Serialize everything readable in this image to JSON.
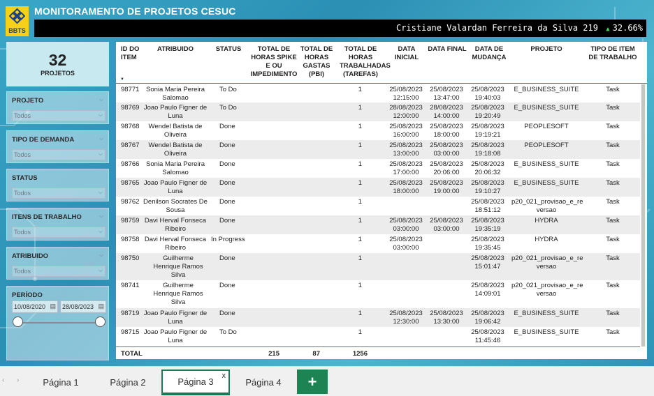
{
  "brand": {
    "logo_text": "BBTS"
  },
  "header": {
    "title": "MONITORAMENTO DE PROJETOS CESUC",
    "user_name": "Cristiane Valardan Ferreira da Silva",
    "user_count": "219",
    "trend_pct": "32.66%"
  },
  "kpi": {
    "value": "32",
    "label": "PROJETOS"
  },
  "filters": [
    {
      "title": "PROJETO",
      "value": "Todos"
    },
    {
      "title": "TIPO DE DEMANDA",
      "value": "Todos"
    },
    {
      "title": "STATUS",
      "value": "Todos"
    },
    {
      "title": "ITENS DE TRABALHO",
      "value": "Todos"
    },
    {
      "title": "ATRIBUIDO",
      "value": "Todos"
    }
  ],
  "periodo": {
    "title": "PERÍODO",
    "start": "10/08/2020",
    "end": "28/08/2023"
  },
  "table": {
    "columns": {
      "id": "ID DO ITEM",
      "atribuido": "ATRIBUIDO",
      "status": "STATUS",
      "horas_spike": "TOTAL DE HORAS SPIKE E OU IMPEDIMENTO",
      "horas_gastas": "TOTAL DE HORAS GASTAS (PBI)",
      "horas_trab": "TOTAL DE HORAS TRABALHADAS (TAREFAS)",
      "data_inicial": "DATA INICIAL",
      "data_final": "DATA FINAL",
      "data_mudanca": "DATA DE MUDANÇA",
      "projeto": "PROJETO",
      "tipo": "TIPO DE ITEM DE TRABALHO"
    },
    "rows": [
      {
        "id": "98771",
        "atribuido": "Sonia Maria Pereira Salomao",
        "status": "To Do",
        "horas_spike": "",
        "horas_gastas": "",
        "horas_trab": "1",
        "data_inicial": "25/08/2023 12:15:00",
        "data_final": "25/08/2023 13:47:00",
        "data_mudanca": "25/08/2023 19:40:03",
        "projeto": "E_BUSINESS_SUITE",
        "tipo": "Task"
      },
      {
        "id": "98769",
        "atribuido": "Joao Paulo Figner de Luna",
        "status": "To Do",
        "horas_spike": "",
        "horas_gastas": "",
        "horas_trab": "1",
        "data_inicial": "28/08/2023 12:00:00",
        "data_final": "28/08/2023 14:00:00",
        "data_mudanca": "25/08/2023 19:20:49",
        "projeto": "E_BUSINESS_SUITE",
        "tipo": "Task"
      },
      {
        "id": "98768",
        "atribuido": "Wendel Batista de Oliveira",
        "status": "Done",
        "horas_spike": "",
        "horas_gastas": "",
        "horas_trab": "1",
        "data_inicial": "25/08/2023 16:00:00",
        "data_final": "25/08/2023 18:00:00",
        "data_mudanca": "25/08/2023 19:19:21",
        "projeto": "PEOPLESOFT",
        "tipo": "Task"
      },
      {
        "id": "98767",
        "atribuido": "Wendel Batista de Oliveira",
        "status": "Done",
        "horas_spike": "",
        "horas_gastas": "",
        "horas_trab": "1",
        "data_inicial": "25/08/2023 13:00:00",
        "data_final": "25/08/2023 03:00:00",
        "data_mudanca": "25/08/2023 19:18:08",
        "projeto": "PEOPLESOFT",
        "tipo": "Task"
      },
      {
        "id": "98766",
        "atribuido": "Sonia Maria Pereira Salomao",
        "status": "Done",
        "horas_spike": "",
        "horas_gastas": "",
        "horas_trab": "1",
        "data_inicial": "25/08/2023 17:00:00",
        "data_final": "25/08/2023 20:06:00",
        "data_mudanca": "25/08/2023 20:06:32",
        "projeto": "E_BUSINESS_SUITE",
        "tipo": "Task"
      },
      {
        "id": "98765",
        "atribuido": "Joao Paulo Figner de Luna",
        "status": "Done",
        "horas_spike": "",
        "horas_gastas": "",
        "horas_trab": "1",
        "data_inicial": "25/08/2023 18:00:00",
        "data_final": "25/08/2023 19:00:00",
        "data_mudanca": "25/08/2023 19:10:27",
        "projeto": "E_BUSINESS_SUITE",
        "tipo": "Task"
      },
      {
        "id": "98762",
        "atribuido": "Denilson Socrates De Sousa",
        "status": "Done",
        "horas_spike": "",
        "horas_gastas": "",
        "horas_trab": "1",
        "data_inicial": "",
        "data_final": "",
        "data_mudanca": "25/08/2023 18:51:12",
        "projeto": "p20_021_provisao_e_re versao",
        "tipo": "Task"
      },
      {
        "id": "98759",
        "atribuido": "Davi Herval Fonseca Ribeiro",
        "status": "Done",
        "horas_spike": "",
        "horas_gastas": "",
        "horas_trab": "1",
        "data_inicial": "25/08/2023 03:00:00",
        "data_final": "25/08/2023 03:00:00",
        "data_mudanca": "25/08/2023 19:35:19",
        "projeto": "HYDRA",
        "tipo": "Task"
      },
      {
        "id": "98758",
        "atribuido": "Davi Herval Fonseca Ribeiro",
        "status": "In Progress",
        "horas_spike": "",
        "horas_gastas": "",
        "horas_trab": "1",
        "data_inicial": "25/08/2023 03:00:00",
        "data_final": "",
        "data_mudanca": "25/08/2023 19:35:45",
        "projeto": "HYDRA",
        "tipo": "Task"
      },
      {
        "id": "98750",
        "atribuido": "Guilherme Henrique Ramos Silva",
        "status": "Done",
        "horas_spike": "",
        "horas_gastas": "",
        "horas_trab": "1",
        "data_inicial": "",
        "data_final": "",
        "data_mudanca": "25/08/2023 15:01:47",
        "projeto": "p20_021_provisao_e_re versao",
        "tipo": "Task"
      },
      {
        "id": "98741",
        "atribuido": "Guilherme Henrique Ramos Silva",
        "status": "Done",
        "horas_spike": "",
        "horas_gastas": "",
        "horas_trab": "1",
        "data_inicial": "",
        "data_final": "",
        "data_mudanca": "25/08/2023 14:09:01",
        "projeto": "p20_021_provisao_e_re versao",
        "tipo": "Task"
      },
      {
        "id": "98719",
        "atribuido": "Joao Paulo Figner de Luna",
        "status": "Done",
        "horas_spike": "",
        "horas_gastas": "",
        "horas_trab": "1",
        "data_inicial": "25/08/2023 12:30:00",
        "data_final": "25/08/2023 13:30:00",
        "data_mudanca": "25/08/2023 19:06:42",
        "projeto": "E_BUSINESS_SUITE",
        "tipo": "Task"
      },
      {
        "id": "98715",
        "atribuido": "Joao Paulo Figner de Luna",
        "status": "To Do",
        "horas_spike": "",
        "horas_gastas": "",
        "horas_trab": "1",
        "data_inicial": "",
        "data_final": "",
        "data_mudanca": "25/08/2023 11:45:46",
        "projeto": "E_BUSINESS_SUITE",
        "tipo": "Task"
      }
    ],
    "totals": {
      "label": "TOTAL",
      "horas_spike": "215",
      "horas_gastas": "87",
      "horas_trab": "1256"
    }
  },
  "tabs": [
    {
      "label": "Página 1",
      "active": false
    },
    {
      "label": "Página 2",
      "active": false
    },
    {
      "label": "Página 3",
      "active": true
    },
    {
      "label": "Página 4",
      "active": false
    }
  ],
  "tab_add_label": "+",
  "colors": {
    "accent": "#1d8352",
    "header_bg": "#000000",
    "brand_yellow": "#f7d117",
    "trend_up": "#3dd64f"
  }
}
